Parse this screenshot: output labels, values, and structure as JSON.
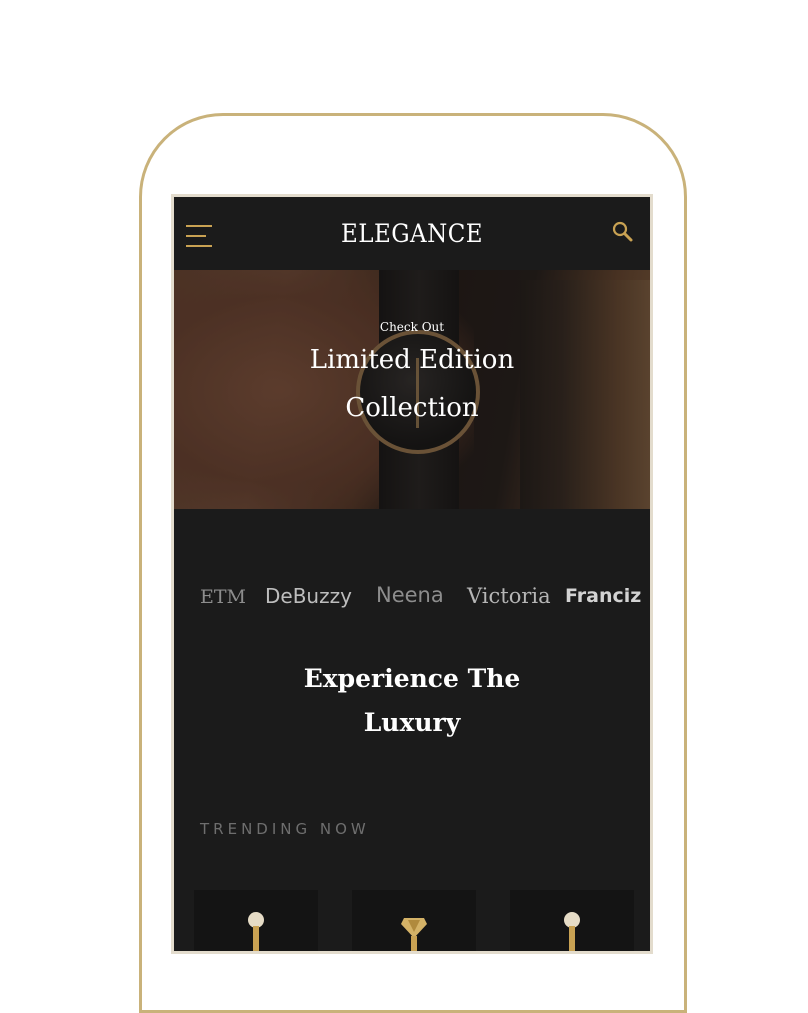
{
  "header": {
    "title": "ELEGANCE",
    "menu_icon": "hamburger-menu-icon",
    "search_icon": "search-icon"
  },
  "hero": {
    "kicker": "Check Out",
    "title_line1": "Limited Edition",
    "title_line2": "Collection"
  },
  "brands": [
    "ETM",
    "DeBuzzy",
    "Neena",
    "Victoria",
    "Franciz"
  ],
  "section": {
    "title_line1": "Experience The",
    "title_line2": "Luxury"
  },
  "trending": {
    "label": "TRENDING NOW",
    "products": [
      {
        "icon": "pearl-earring-icon"
      },
      {
        "icon": "gem-ring-icon"
      },
      {
        "icon": "pearl-earring-icon"
      }
    ]
  },
  "colors": {
    "accent": "#c9a253",
    "frame": "#c9b27a",
    "background": "#1b1b1b",
    "text": "#ffffff"
  }
}
